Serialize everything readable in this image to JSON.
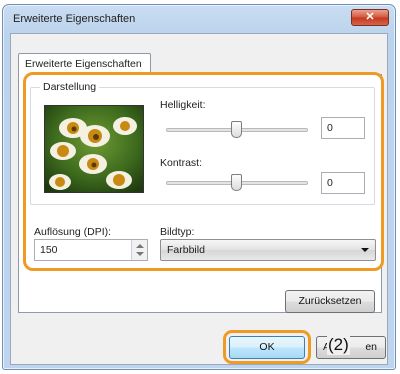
{
  "window": {
    "title": "Erweiterte Eigenschaften",
    "close_glyph": "✕"
  },
  "tabs": [
    {
      "label": "Erweiterte Eigenschaften"
    }
  ],
  "display_group": {
    "label": "Darstellung",
    "brightness": {
      "label": "Helligkeit:",
      "value": "0",
      "slider_level": 0.5
    },
    "contrast": {
      "label": "Kontrast:",
      "value": "0",
      "slider_level": 0.5
    }
  },
  "resolution": {
    "label": "Auflösung (DPI):",
    "value": "150"
  },
  "image_type": {
    "label": "Bildtyp:",
    "selected": "Farbbild"
  },
  "buttons": {
    "reset": "Zurücksetzen",
    "ok": "OK",
    "abort_start": "A",
    "abort_end": "en"
  },
  "annotations": {
    "ok_callout": "(2)"
  },
  "colors": {
    "highlight": "#ef9a24",
    "close_button": "#c0391f"
  }
}
